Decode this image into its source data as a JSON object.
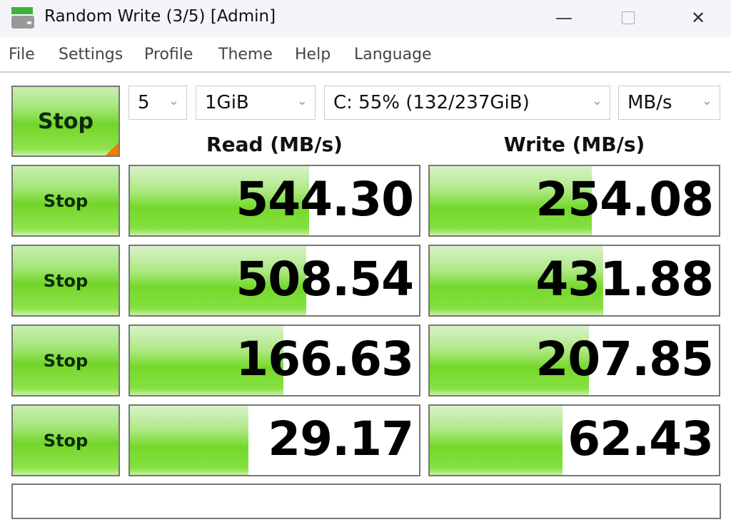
{
  "window": {
    "title": "Random Write (3/5) [Admin]",
    "app_icon": "drive-icon",
    "controls": [
      "minimize-icon",
      "maximize-icon",
      "close-icon"
    ]
  },
  "menu": [
    "File",
    "Settings",
    "Profile",
    "Theme",
    "Help",
    "Language"
  ],
  "toolbar": {
    "main_button": "Stop",
    "count": "5",
    "size": "1GiB",
    "drive": "C: 55% (132/237GiB)",
    "unit": "MB/s"
  },
  "headers": {
    "read": "Read (MB/s)",
    "write": "Write (MB/s)"
  },
  "rows": [
    {
      "button": "Stop",
      "read": "544.30",
      "read_fill": 0.62,
      "write": "254.08",
      "write_fill": 0.56
    },
    {
      "button": "Stop",
      "read": "508.54",
      "read_fill": 0.61,
      "write": "431.88",
      "write_fill": 0.6
    },
    {
      "button": "Stop",
      "read": "166.63",
      "read_fill": 0.53,
      "write": "207.85",
      "write_fill": 0.55
    },
    {
      "button": "Stop",
      "read": "29.17",
      "read_fill": 0.41,
      "write": "62.43",
      "write_fill": 0.46
    }
  ],
  "comment": "",
  "colors": {
    "accent_green": "#72d629",
    "corner_marker": "#f07c00"
  }
}
